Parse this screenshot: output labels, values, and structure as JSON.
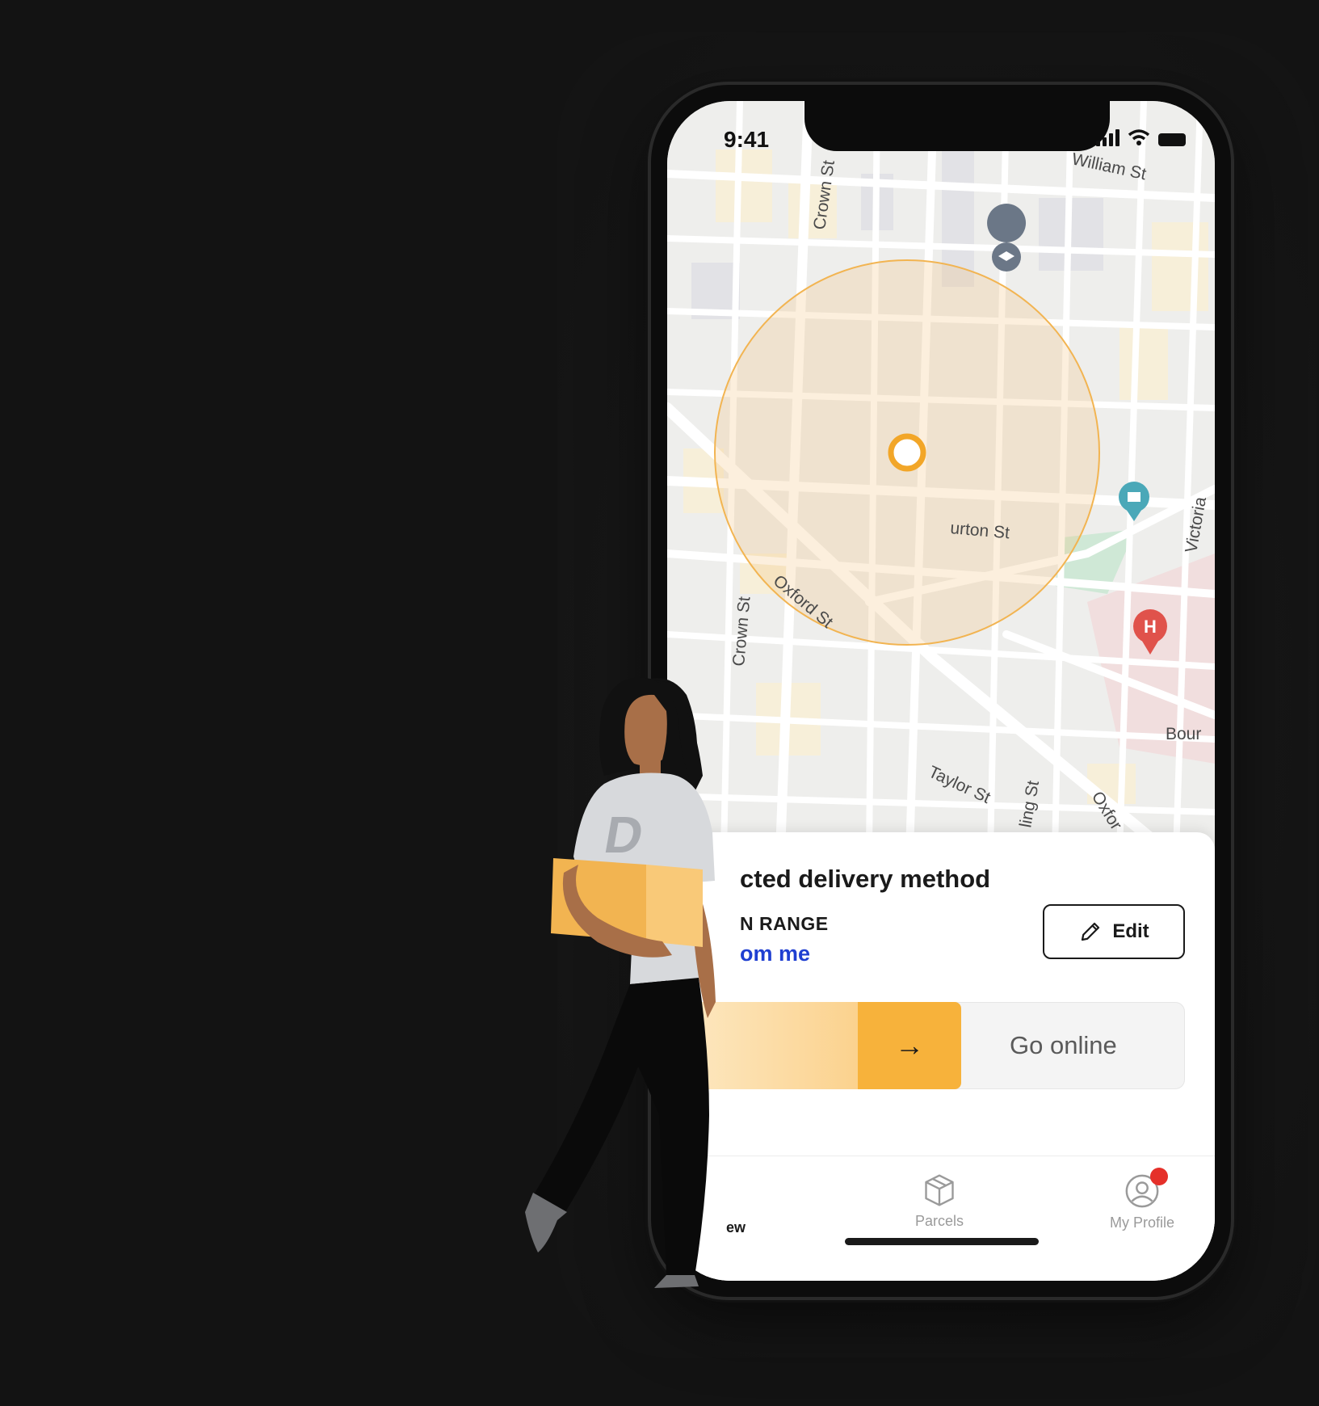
{
  "status": {
    "time": "9:41"
  },
  "map": {
    "streets": {
      "crown_top": "Crown St",
      "william": "William St",
      "burton": "urton St",
      "victoria": "Victoria",
      "oxford": "Oxford St",
      "crown_bottom": "Crown St",
      "taylor": "Taylor St",
      "ling": "ling St",
      "oxford_bottom": "Oxfor",
      "bourke": "Bour"
    },
    "hospital_marker_label": "H"
  },
  "delivery": {
    "title": "cted delivery method",
    "range_label": "N RANGE",
    "range_value": "om me",
    "edit_label": "Edit"
  },
  "slider": {
    "arrow": "→",
    "label": "Go online"
  },
  "tabs": {
    "overview": "ew",
    "parcels": "Parcels",
    "profile": "My Profile"
  },
  "person": {
    "shirt_logo": "D"
  },
  "colors": {
    "accent": "#f7b23b",
    "range_circle": "#f2c176",
    "link_blue": "#1f3fd1",
    "notification": "#e5302a"
  }
}
